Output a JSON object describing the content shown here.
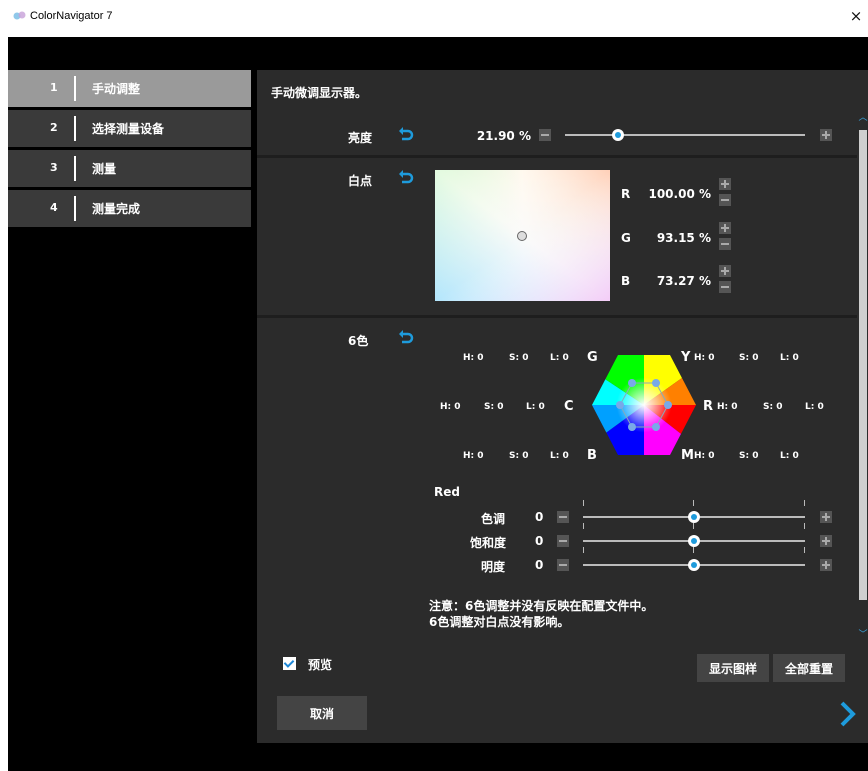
{
  "window": {
    "title": "ColorNavigator 7",
    "close_glyph": "×"
  },
  "steps": [
    {
      "num": "1",
      "label": "手动调整"
    },
    {
      "num": "2",
      "label": "选择测量设备"
    },
    {
      "num": "3",
      "label": "测量"
    },
    {
      "num": "4",
      "label": "测量完成"
    }
  ],
  "main": {
    "hint": "手动微调显示器。",
    "brightness": {
      "label": "亮度",
      "value": "21.90 %",
      "level_percent": 21.9
    },
    "whitepoint": {
      "label": "白点",
      "R": {
        "label": "R",
        "value": "100.00 %"
      },
      "G": {
        "label": "G",
        "value": "93.15 %"
      },
      "B": {
        "label": "B",
        "value": "73.27 %"
      }
    },
    "sixcolor": {
      "label": "6色",
      "letters": {
        "G": "G",
        "Y": "Y",
        "C": "C",
        "R": "R",
        "B": "B",
        "M": "M"
      },
      "hsl": {
        "H": "H: 0",
        "S": "S: 0",
        "L": "L: 0"
      },
      "selected": "Red",
      "hue": {
        "label": "色调",
        "value": "0"
      },
      "sat": {
        "label": "饱和度",
        "value": "0"
      },
      "light": {
        "label": "明度",
        "value": "0"
      },
      "note1": "注意：6色调整并没有反映在配置文件中。",
      "note2": "6色调整对白点没有影响。"
    }
  },
  "footer": {
    "preview_label": "预览",
    "preview_checked": true,
    "show_pattern": "显示图样",
    "reset_all": "全部重置",
    "cancel": "取消"
  },
  "colors": {
    "accent": "#1e9bdc",
    "panel": "#2b2b2b",
    "active_step": "#9a9a9a"
  }
}
